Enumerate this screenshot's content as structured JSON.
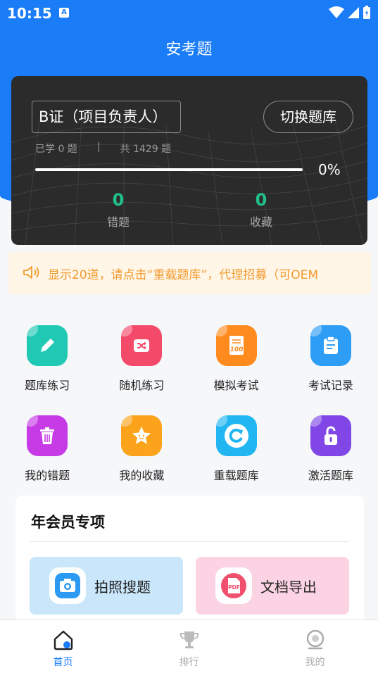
{
  "status_bar": {
    "time": "10:15",
    "notif_badge": "A"
  },
  "header": {
    "title": "安考题"
  },
  "card": {
    "bank_name": "B证（项目负责人）",
    "switch_button": "切换题库",
    "learned": "已学 0 题",
    "separator": "|",
    "total": "共 1429 题",
    "progress_fraction": 0,
    "progress_text": "0%",
    "wrong_count": "0",
    "wrong_label": "错题",
    "fav_count": "0",
    "fav_label": "收藏"
  },
  "notice": {
    "text": "显示20道，请点击“重载题库”，代理招募（可OEM"
  },
  "menu_row1": [
    {
      "label": "题库练习",
      "icon": "pencil-icon",
      "color": "#20c9b4"
    },
    {
      "label": "随机练习",
      "icon": "shuffle-icon",
      "color": "#f44a6a"
    },
    {
      "label": "模拟考试",
      "icon": "exam-paper-icon",
      "color": "#ff8a1e"
    },
    {
      "label": "考试记录",
      "icon": "clipboard-icon",
      "color": "#2e9df5"
    }
  ],
  "menu_row2": [
    {
      "label": "我的错题",
      "icon": "trash-icon",
      "color": "#c63be6"
    },
    {
      "label": "我的收藏",
      "icon": "star-icon",
      "color": "#fba31a"
    },
    {
      "label": "重载题库",
      "icon": "reload-icon",
      "color": "#21b6f2"
    },
    {
      "label": "激活题库",
      "icon": "unlock-icon",
      "color": "#8047e6"
    }
  ],
  "vip": {
    "title": "年会员专项",
    "photo_search": {
      "label": "拍照搜题",
      "bg": "#c9e6fb",
      "accent": "#2c9af2"
    },
    "doc_export": {
      "label": "文档导出",
      "bg": "#fcd3e3",
      "accent": "#f0506e",
      "icon_text": "PDF"
    }
  },
  "tabbar": [
    {
      "label": "首页",
      "icon": "home-icon",
      "active": true
    },
    {
      "label": "排行",
      "icon": "trophy-icon",
      "active": false
    },
    {
      "label": "我的",
      "icon": "profile-icon",
      "active": false
    }
  ],
  "colors": {
    "primary": "#1a7cf6",
    "success": "#22c08a",
    "notice": "#f29a2e"
  }
}
